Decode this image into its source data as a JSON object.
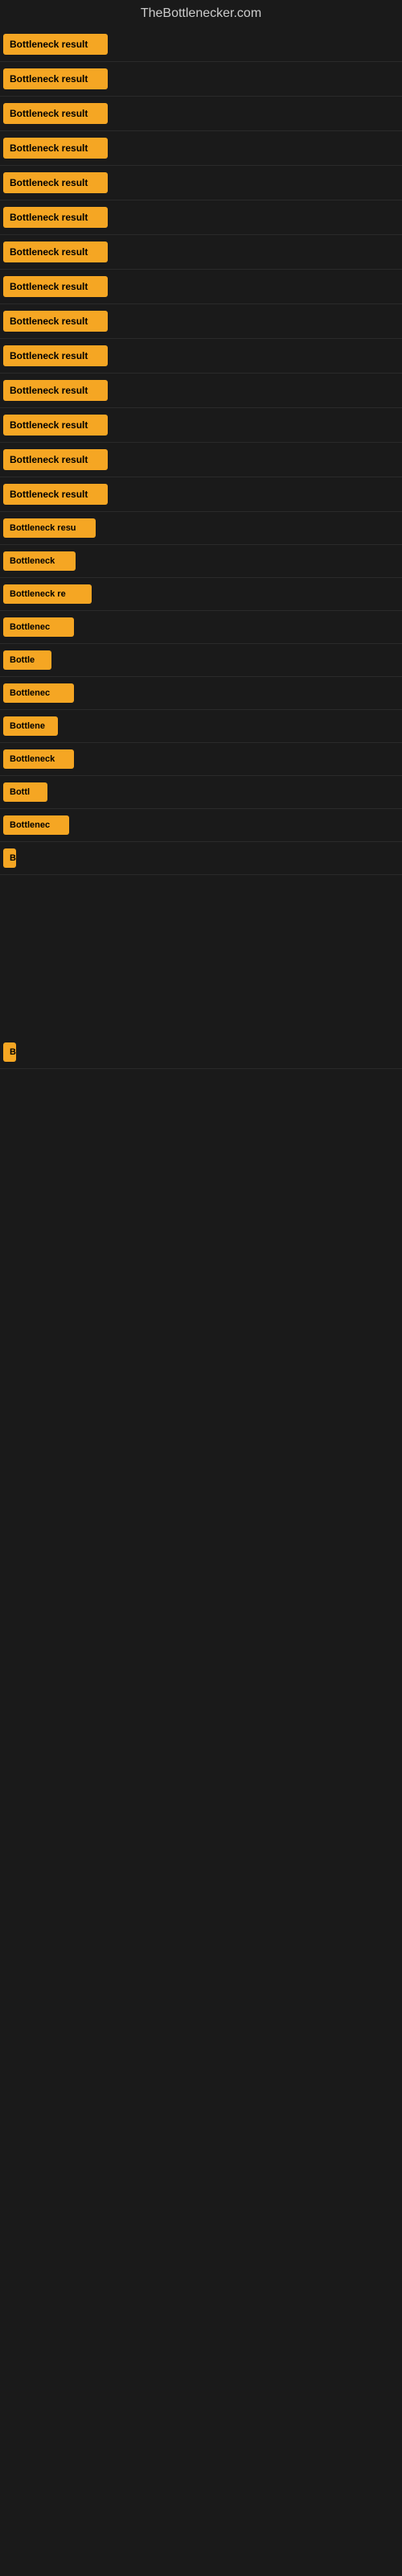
{
  "site": {
    "title": "TheBottlenecker.com"
  },
  "items": [
    {
      "id": 1,
      "label": "Bottleneck result"
    },
    {
      "id": 2,
      "label": "Bottleneck result"
    },
    {
      "id": 3,
      "label": "Bottleneck result"
    },
    {
      "id": 4,
      "label": "Bottleneck result"
    },
    {
      "id": 5,
      "label": "Bottleneck result"
    },
    {
      "id": 6,
      "label": "Bottleneck result"
    },
    {
      "id": 7,
      "label": "Bottleneck result"
    },
    {
      "id": 8,
      "label": "Bottleneck result"
    },
    {
      "id": 9,
      "label": "Bottleneck result"
    },
    {
      "id": 10,
      "label": "Bottleneck result"
    },
    {
      "id": 11,
      "label": "Bottleneck result"
    },
    {
      "id": 12,
      "label": "Bottleneck result"
    },
    {
      "id": 13,
      "label": "Bottleneck result"
    },
    {
      "id": 14,
      "label": "Bottleneck result"
    },
    {
      "id": 15,
      "label": "Bottleneck resu"
    },
    {
      "id": 16,
      "label": "Bottleneck"
    },
    {
      "id": 17,
      "label": "Bottleneck re"
    },
    {
      "id": 18,
      "label": "Bottlenec"
    },
    {
      "id": 19,
      "label": "Bottle"
    },
    {
      "id": 20,
      "label": "Bottlenec"
    },
    {
      "id": 21,
      "label": "Bottlene"
    },
    {
      "id": 22,
      "label": "Bottleneck"
    },
    {
      "id": 23,
      "label": "Bottl"
    },
    {
      "id": 24,
      "label": "Bottlenec"
    },
    {
      "id": 25,
      "label": "B"
    },
    {
      "id": 26,
      "label": "B"
    }
  ],
  "colors": {
    "badge_bg": "#f5a623",
    "badge_text": "#000000",
    "page_bg": "#1a1a1a",
    "title_color": "#cccccc"
  }
}
